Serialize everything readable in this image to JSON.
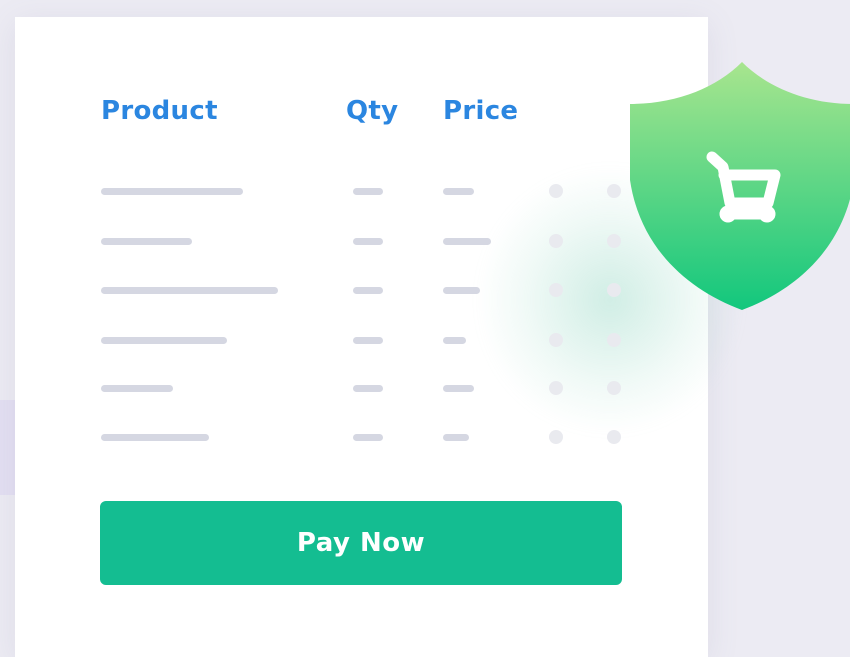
{
  "table": {
    "headers": {
      "product": "Product",
      "qty": "Qty",
      "price": "Price"
    },
    "rows": [
      {
        "placeholder": true
      },
      {
        "placeholder": true
      },
      {
        "placeholder": true
      },
      {
        "placeholder": true
      },
      {
        "placeholder": true
      },
      {
        "placeholder": true
      }
    ]
  },
  "checkout": {
    "pay_label": "Pay Now"
  },
  "badge": {
    "icon": "shopping-cart-icon",
    "shape": "shield"
  },
  "colors": {
    "header_text": "#2b86e0",
    "button_bg": "#14bd91",
    "placeholder_bar": "#d5d7e2",
    "shield_top": "#a8e58e",
    "shield_bottom": "#12c77d"
  }
}
